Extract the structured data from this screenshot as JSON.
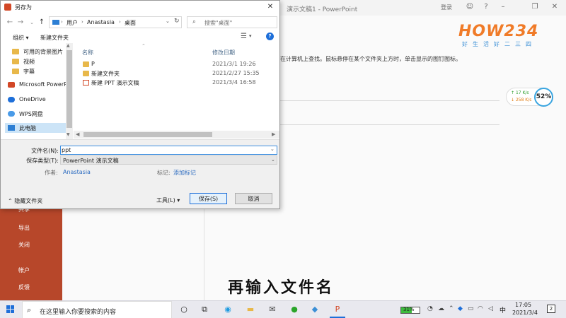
{
  "app": {
    "title": "演示文稿1 - PowerPoint",
    "login": "登录",
    "hint": "在计算机上查找。鼠标悬停在某个文件夹上方时，单击显示的图钉图标。",
    "sidebar": [
      "共享",
      "导出",
      "关闭",
      "帐户",
      "反馈"
    ]
  },
  "logo": {
    "text": "HOW234",
    "sub": "好生活好二三四"
  },
  "netspeed": {
    "up": "17 K/s",
    "down": "258 K/s",
    "percent": "52%"
  },
  "dialog": {
    "title": "另存为",
    "breadcrumb": [
      "用户",
      "Anastasia",
      "桌面"
    ],
    "search_placeholder": "搜索\"桌面\"",
    "organize": "组织 ▾",
    "new_folder": "新建文件夹",
    "nav_items": [
      {
        "label": "可用的背景图片",
        "icon": "folder-icon"
      },
      {
        "label": "视频",
        "icon": "folder-icon"
      },
      {
        "label": "字幕",
        "icon": "folder-icon"
      },
      {
        "label": "Microsoft PowerPoint",
        "icon": "powerpoint-icon"
      },
      {
        "label": "OneDrive",
        "icon": "cloud-icon"
      },
      {
        "label": "WPS网盘",
        "icon": "cloud-icon"
      },
      {
        "label": "此电脑",
        "icon": "computer-icon"
      }
    ],
    "columns": {
      "name": "名称",
      "date": "修改日期"
    },
    "files": [
      {
        "name": "P",
        "date": "2021/3/1 19:26",
        "icon": "folder-icon"
      },
      {
        "name": "新建文件夹",
        "date": "2021/2/27 15:35",
        "icon": "folder-icon"
      },
      {
        "name": "新建 PPT 演示文稿",
        "date": "2021/3/4 16:58",
        "icon": "ppt-file-icon"
      }
    ],
    "filename_label": "文件名(N):",
    "filename_value": "ppt",
    "filetype_label": "保存类型(T):",
    "filetype_value": "PowerPoint 演示文稿",
    "author_label": "作者:",
    "author_value": "Anastasia",
    "tags_label": "标记:",
    "tags_value": "添加标记",
    "hide_folders": "隐藏文件夹",
    "tools": "工具(L)",
    "save": "保存(S)",
    "cancel": "取消"
  },
  "subtitle": "再输入文件名",
  "taskbar": {
    "search_placeholder": "在这里输入你要搜索的内容",
    "battery": "31%",
    "ime": "中",
    "time": "17:05",
    "date": "2021/3/4",
    "notifications": "2"
  },
  "colors": {
    "accent": "#1e6fd9",
    "powerpoint": "#b7472a",
    "logo_orange": "#f07b28",
    "logo_blue": "#3a8fd6"
  }
}
